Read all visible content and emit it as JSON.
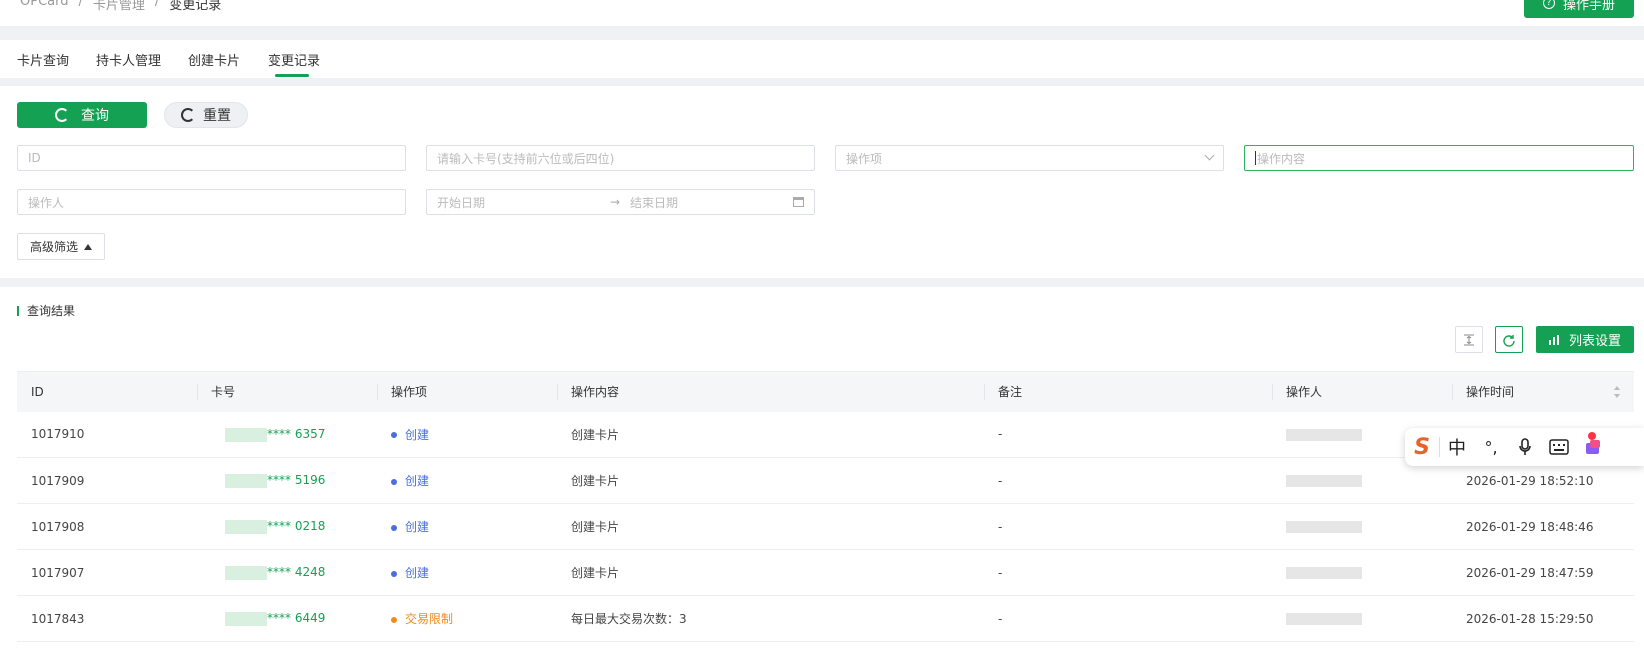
{
  "breadcrumb": [
    "OPCard",
    "/",
    "卡片管理",
    "/",
    "变更记录"
  ],
  "manual_button": "操作手册",
  "tabs": [
    {
      "label": "卡片查询",
      "active": false
    },
    {
      "label": "持卡人管理",
      "active": false
    },
    {
      "label": "创建卡片",
      "active": false
    },
    {
      "label": "变更记录",
      "active": true
    }
  ],
  "filter": {
    "query_label": "查询",
    "reset_label": "重置",
    "id_placeholder": "ID",
    "card_placeholder": "请输入卡号(支持前六位或后四位)",
    "op_item_placeholder": "操作项",
    "op_content_placeholder": "操作内容",
    "operator_placeholder": "操作人",
    "start_date_placeholder": "开始日期",
    "range_arrow": "→",
    "end_date_placeholder": "结束日期",
    "advanced_label": "高级筛选"
  },
  "results": {
    "title": "查询结果",
    "column_settings": "列表设置",
    "columns": [
      "ID",
      "卡号",
      "操作项",
      "操作内容",
      "备注",
      "操作人",
      "操作时间"
    ],
    "rows": [
      {
        "id": "1017910",
        "card": "**** 6357",
        "op": "创建",
        "op_color": "#4a6ee0",
        "content": "创建卡片",
        "remark": "-",
        "time": ""
      },
      {
        "id": "1017909",
        "card": "**** 5196",
        "op": "创建",
        "op_color": "#4a6ee0",
        "content": "创建卡片",
        "remark": "-",
        "time": "2026-01-29 18:52:10"
      },
      {
        "id": "1017908",
        "card": "**** 0218",
        "op": "创建",
        "op_color": "#4a6ee0",
        "content": "创建卡片",
        "remark": "-",
        "time": "2026-01-29 18:48:46"
      },
      {
        "id": "1017907",
        "card": "**** 4248",
        "op": "创建",
        "op_color": "#4a6ee0",
        "content": "创建卡片",
        "remark": "-",
        "time": "2026-01-29 18:47:59"
      },
      {
        "id": "1017843",
        "card": "**** 6449",
        "op": "交易限制",
        "op_color": "#f08c1a",
        "content": "每日最大交易次数：3",
        "remark": "-",
        "time": "2026-01-28 15:29:50"
      }
    ]
  },
  "ime": {
    "logo": "S",
    "lang": "中",
    "punct": "°,"
  },
  "colors": {
    "brand": "#15a153",
    "create": "#4a6ee0",
    "limit": "#f08c1a"
  }
}
